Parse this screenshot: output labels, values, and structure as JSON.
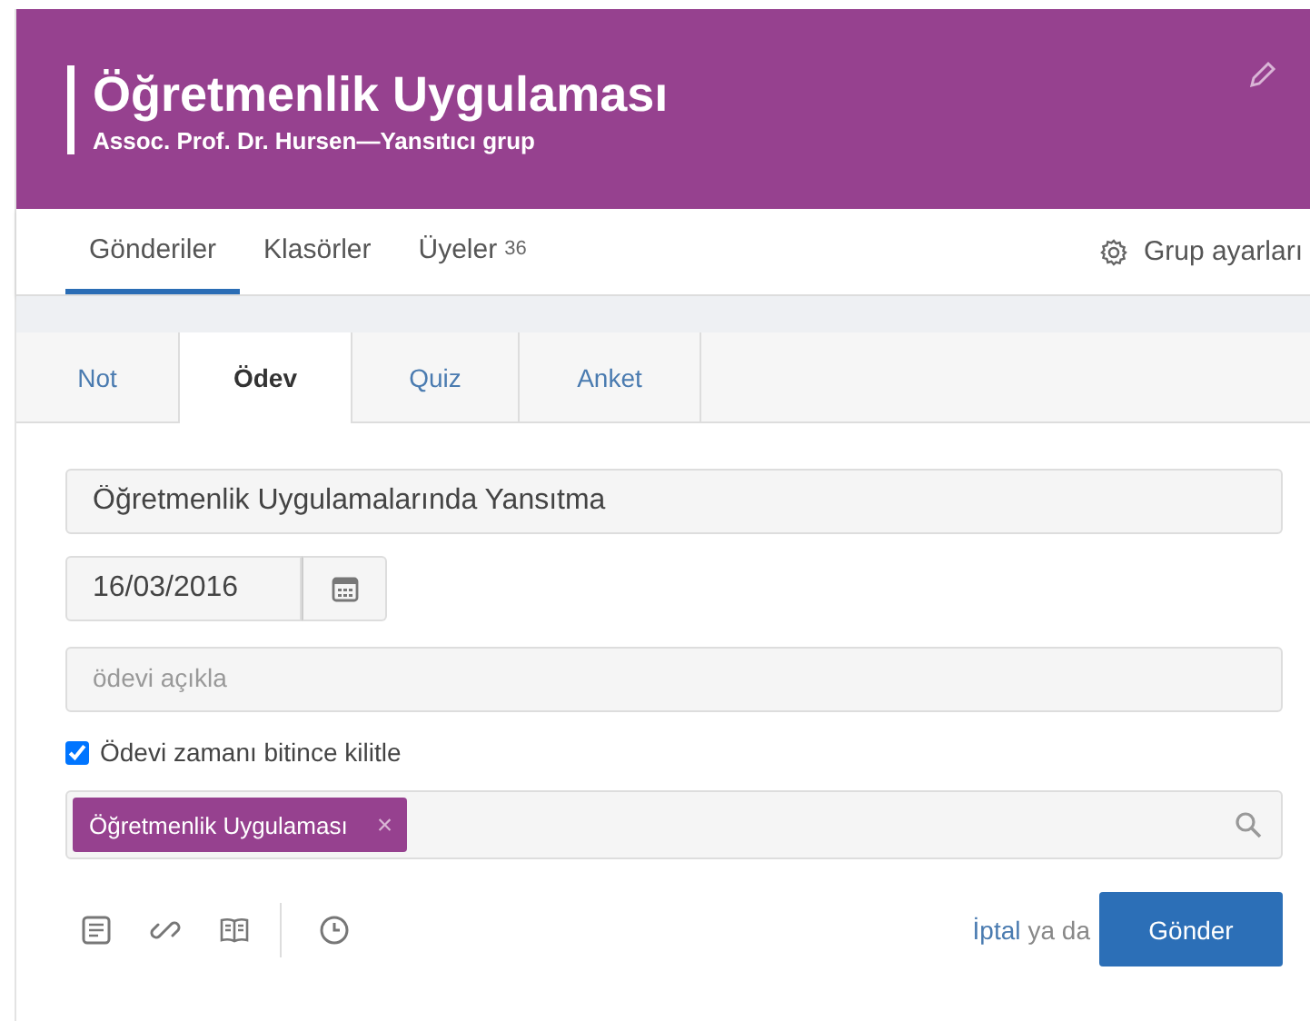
{
  "header": {
    "title": "Öğretmenlik Uygulaması",
    "subtitle": "Assoc. Prof. Dr. Hursen—Yansıtıcı grup"
  },
  "nav": {
    "items": [
      {
        "label": "Gönderiler",
        "selected": true
      },
      {
        "label": "Klasörler",
        "selected": false
      },
      {
        "label": "Üyeler",
        "count": "36",
        "selected": false
      }
    ],
    "settings": "Grup ayarları"
  },
  "tabs": [
    {
      "label": "Not",
      "selected": false
    },
    {
      "label": "Ödev",
      "selected": true
    },
    {
      "label": "Quiz",
      "selected": false
    },
    {
      "label": "Anket",
      "selected": false
    }
  ],
  "form": {
    "title_value": "Öğretmenlik Uygulamalarında Yansıtma",
    "date_value": "16/03/2016",
    "description_placeholder": "ödevi açıkla",
    "lock": {
      "label": "Ödevi zamanı bitince kilitle",
      "checked": true
    },
    "recipients": [
      {
        "label": "Öğretmenlik Uygulaması",
        "remove": "×"
      }
    ],
    "cancel": "İptal",
    "separator": "ya da",
    "submit": "Gönder"
  }
}
